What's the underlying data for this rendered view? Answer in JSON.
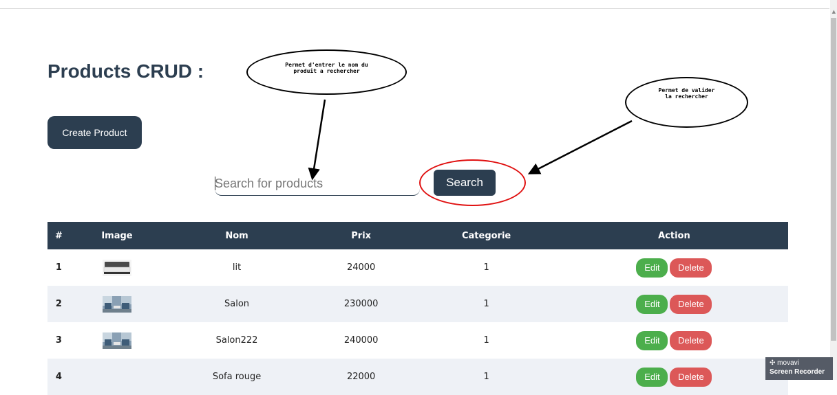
{
  "page": {
    "title": "Products CRUD :"
  },
  "toolbar": {
    "create_label": "Create Product"
  },
  "search": {
    "placeholder": "Search for products",
    "value": "",
    "button_label": "Search"
  },
  "annotations": {
    "note1": "Permet d'entrer le nom du\nproduit a rechercher",
    "note2": "Permet de valider\nla rechercher",
    "ring_color": "#e01010"
  },
  "table": {
    "headers": [
      "#",
      "Image",
      "Nom",
      "Prix",
      "Categorie",
      "Action"
    ],
    "rows": [
      {
        "id": "1",
        "image": "bed",
        "nom": "lit",
        "prix": "24000",
        "categorie": "1"
      },
      {
        "id": "2",
        "image": "living-room",
        "nom": "Salon",
        "prix": "230000",
        "categorie": "1"
      },
      {
        "id": "3",
        "image": "living-room",
        "nom": "Salon222",
        "prix": "240000",
        "categorie": "1"
      },
      {
        "id": "4",
        "image": "",
        "nom": "Sofa rouge",
        "prix": "22000",
        "categorie": "1"
      }
    ],
    "edit_label": "Edit",
    "delete_label": "Delete"
  },
  "watermark": {
    "brand": "movavi",
    "product": "Screen Recorder"
  },
  "colors": {
    "primary": "#2c3e50",
    "edit": "#4cae4c",
    "delete": "#dc5858",
    "stripe": "#eef1f6"
  }
}
